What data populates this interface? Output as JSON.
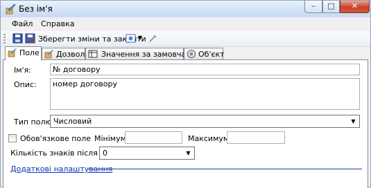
{
  "window": {
    "title": "Без ім'я",
    "minimize": "–",
    "maximize": "□",
    "close": "✕"
  },
  "menu": {
    "file": "Файл",
    "help": "Справка"
  },
  "toolbar": {
    "save_close_label": "Зберегти зміни та закрити"
  },
  "tabs": [
    {
      "label": "Поле"
    },
    {
      "label": "Дозволи"
    },
    {
      "label": "Значення за замовчанням"
    },
    {
      "label": "Об'єкт"
    }
  ],
  "form": {
    "name_label": "Ім'я:",
    "name_value": "№ договору",
    "desc_label": "Опис:",
    "desc_value": "номер договору",
    "type_label": "Тип полю:",
    "type_value": "Числовий",
    "required_label": "Обов'язкове поле",
    "min_label": "Мінімум:",
    "min_value": "",
    "max_label": "Максимум:",
    "max_value": "",
    "decimals_label": "Кількість знаків після коми:",
    "decimals_value": "0",
    "advanced_link": "Додаткові налаштування"
  },
  "colors": {
    "link": "#0033cc",
    "separator": "#1a3f9b"
  }
}
